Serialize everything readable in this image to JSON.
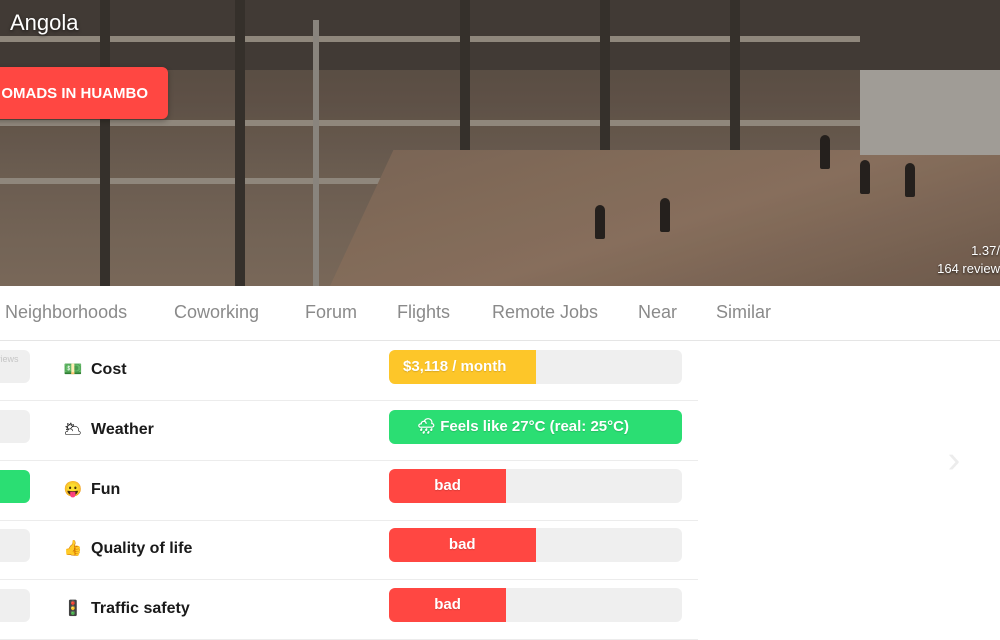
{
  "hero": {
    "title": "Angola",
    "cta_label": "OMADS IN HUAMBO",
    "rating": "1.37/",
    "reviews": "164 review"
  },
  "tabs": [
    {
      "label": "Neighborhoods"
    },
    {
      "label": "Coworking"
    },
    {
      "label": "Forum"
    },
    {
      "label": "Flights"
    },
    {
      "label": "Remote Jobs"
    },
    {
      "label": "Near"
    },
    {
      "label": "Similar"
    }
  ],
  "left_column": {
    "first_pill_text": "views"
  },
  "scores": [
    {
      "icon": "💵",
      "icon_name": "money-icon",
      "label": "Cost",
      "value_text": "$3,118 / month",
      "fill": 0.5,
      "color": "#fdc629"
    },
    {
      "icon": "🌥",
      "icon_name": "cloud-icon",
      "label": "Weather",
      "value_text": "🌧 Feels like 27°C (real: 25°C)",
      "fill": 1.0,
      "color": "#2bde73"
    },
    {
      "icon": "😛",
      "icon_name": "face-icon",
      "label": "Fun",
      "value_text": "bad",
      "fill": 0.4,
      "color": "#ff4742"
    },
    {
      "icon": "👍",
      "icon_name": "thumbs-up-icon",
      "label": "Quality of life",
      "value_text": "bad",
      "fill": 0.5,
      "color": "#ff4742"
    },
    {
      "icon": "🚦",
      "icon_name": "traffic-light-icon",
      "label": "Traffic safety",
      "value_text": "bad",
      "fill": 0.4,
      "color": "#ff4742"
    }
  ],
  "carousel": {
    "next_icon": "chevron-right-icon"
  }
}
